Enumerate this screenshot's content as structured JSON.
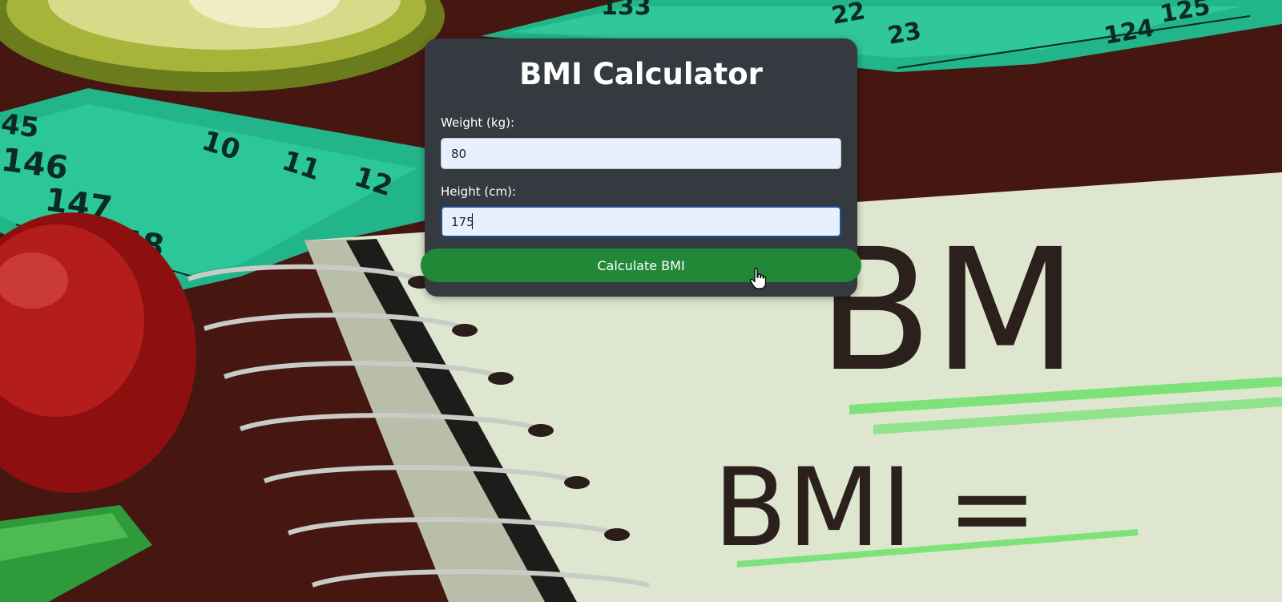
{
  "app": {
    "title": "BMI Calculator"
  },
  "form": {
    "weight": {
      "label": "Weight (kg):",
      "value": "80"
    },
    "height": {
      "label": "Height (cm):",
      "value": "175"
    },
    "submit_label": "Calculate BMI"
  },
  "colors": {
    "card_bg": "#343a40",
    "button_bg": "#218838",
    "input_bg": "#e8f0fe"
  },
  "background_image": {
    "handwritten_text": [
      "BM",
      "BMI ="
    ],
    "tape_numbers": [
      "133",
      "124",
      "23",
      "22",
      "124",
      "125",
      "45",
      "146",
      "147",
      "148",
      "10",
      "11",
      "12"
    ]
  },
  "icons": {
    "cursor": "hand-pointer-icon"
  }
}
